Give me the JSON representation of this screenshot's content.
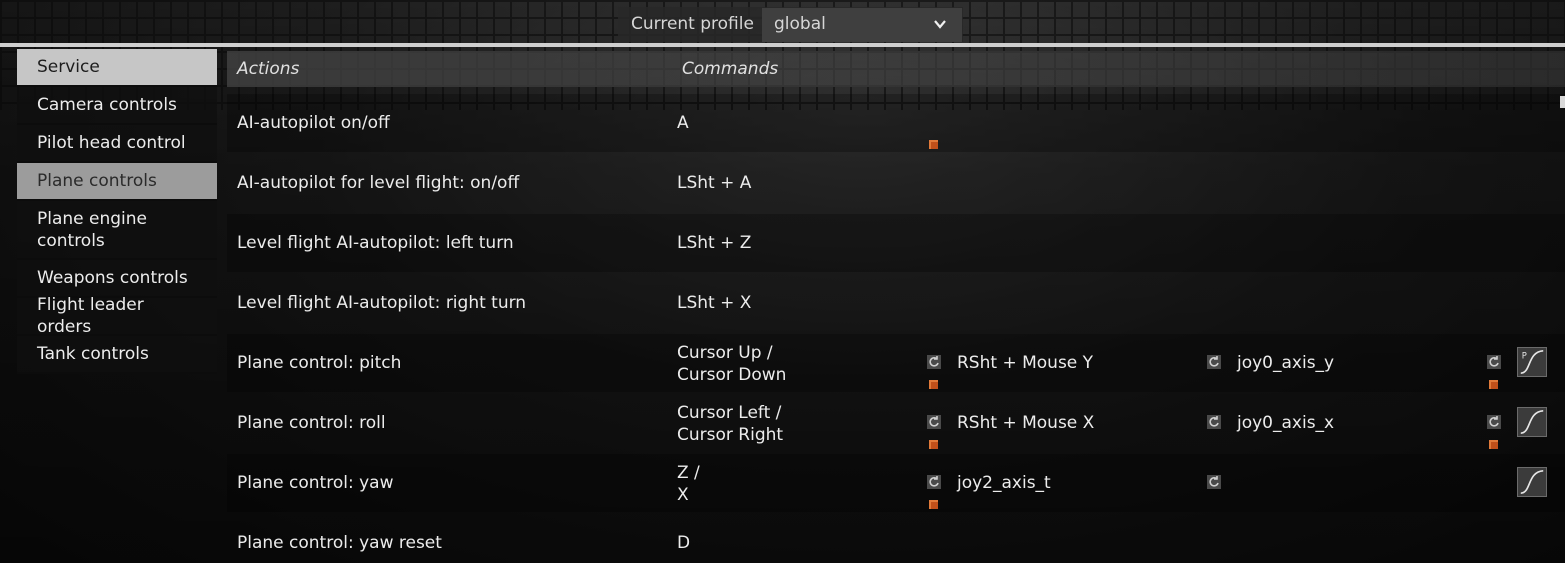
{
  "profile": {
    "label": "Current profile",
    "value": "global"
  },
  "sidebar": {
    "items": [
      {
        "label": "Service"
      },
      {
        "label": "Camera controls"
      },
      {
        "label": "Pilot head control"
      },
      {
        "label": "Plane controls"
      },
      {
        "label": "Plane engine controls"
      },
      {
        "label": "Weapons controls"
      },
      {
        "label": "Flight leader orders"
      },
      {
        "label": "Tank controls"
      }
    ],
    "active_index": 3
  },
  "table": {
    "headers": {
      "actions": "Actions",
      "commands": "Commands"
    },
    "rows": [
      {
        "action": "AI-autopilot on/off",
        "command": "A"
      },
      {
        "action": "AI-autopilot for level flight: on/off",
        "command": "LSht + A"
      },
      {
        "action": "Level flight AI-autopilot: left turn",
        "command": "LSht + Z"
      },
      {
        "action": "Level flight AI-autopilot: right turn",
        "command": "LSht + X"
      },
      {
        "action": "Plane control: pitch",
        "command_line1": "Cursor Up /",
        "command_line2": "Cursor Down",
        "binding2": "RSht + Mouse Y",
        "binding3": "joy0_axis_y"
      },
      {
        "action": "Plane control: roll",
        "command_line1": "Cursor Left /",
        "command_line2": "Cursor Right",
        "binding2": "RSht + Mouse X",
        "binding3": "joy0_axis_x"
      },
      {
        "action": "Plane control: yaw",
        "command_line1": "Z /",
        "command_line2": "X",
        "binding2": "joy2_axis_t"
      },
      {
        "action": "Plane control: yaw reset",
        "command": "D"
      }
    ]
  },
  "icons": {
    "reset": "reset-binding-icon",
    "marker": "binding-marker-icon",
    "curve": "axis-curve-icon",
    "curve_badge": "P"
  },
  "colors": {
    "accent_marker": "#c0501a",
    "active_tab": "#9c9c9c"
  }
}
